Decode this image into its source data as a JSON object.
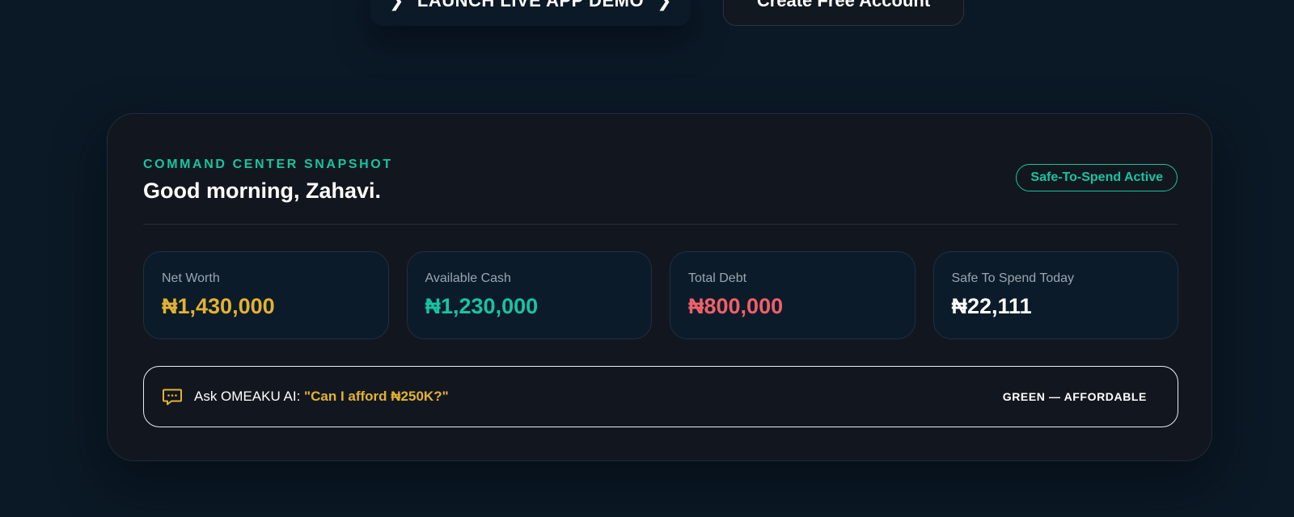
{
  "hero": {
    "demo_button_label": "LAUNCH LIVE APP DEMO",
    "account_button_label": "Create Free Account"
  },
  "snapshot": {
    "eyebrow": "COMMAND CENTER SNAPSHOT",
    "greeting": "Good morning, Zahavi.",
    "status_badge": "Safe-To-Spend Active",
    "metrics": [
      {
        "label": "Net Worth",
        "value": "₦1,430,000",
        "color": "#e2b233"
      },
      {
        "label": "Available Cash",
        "value": "₦1,230,000",
        "color": "#19c3a0"
      },
      {
        "label": "Total Debt",
        "value": "₦800,000",
        "color": "#f0606a"
      },
      {
        "label": "Safe To Spend Today",
        "value": "₦22,111",
        "color": "#ffffff"
      }
    ],
    "ask": {
      "icon": "chat-bubble-icon",
      "prefix": "Ask OMEAKU AI: ",
      "question": "\"Can I afford ₦250K?\"",
      "verdict": "GREEN — AFFORDABLE"
    }
  },
  "colors": {
    "accent_teal": "#19c3a0",
    "accent_gold": "#e2b233",
    "accent_red": "#f0606a",
    "background": "#0b1926",
    "card": "#12171f"
  }
}
